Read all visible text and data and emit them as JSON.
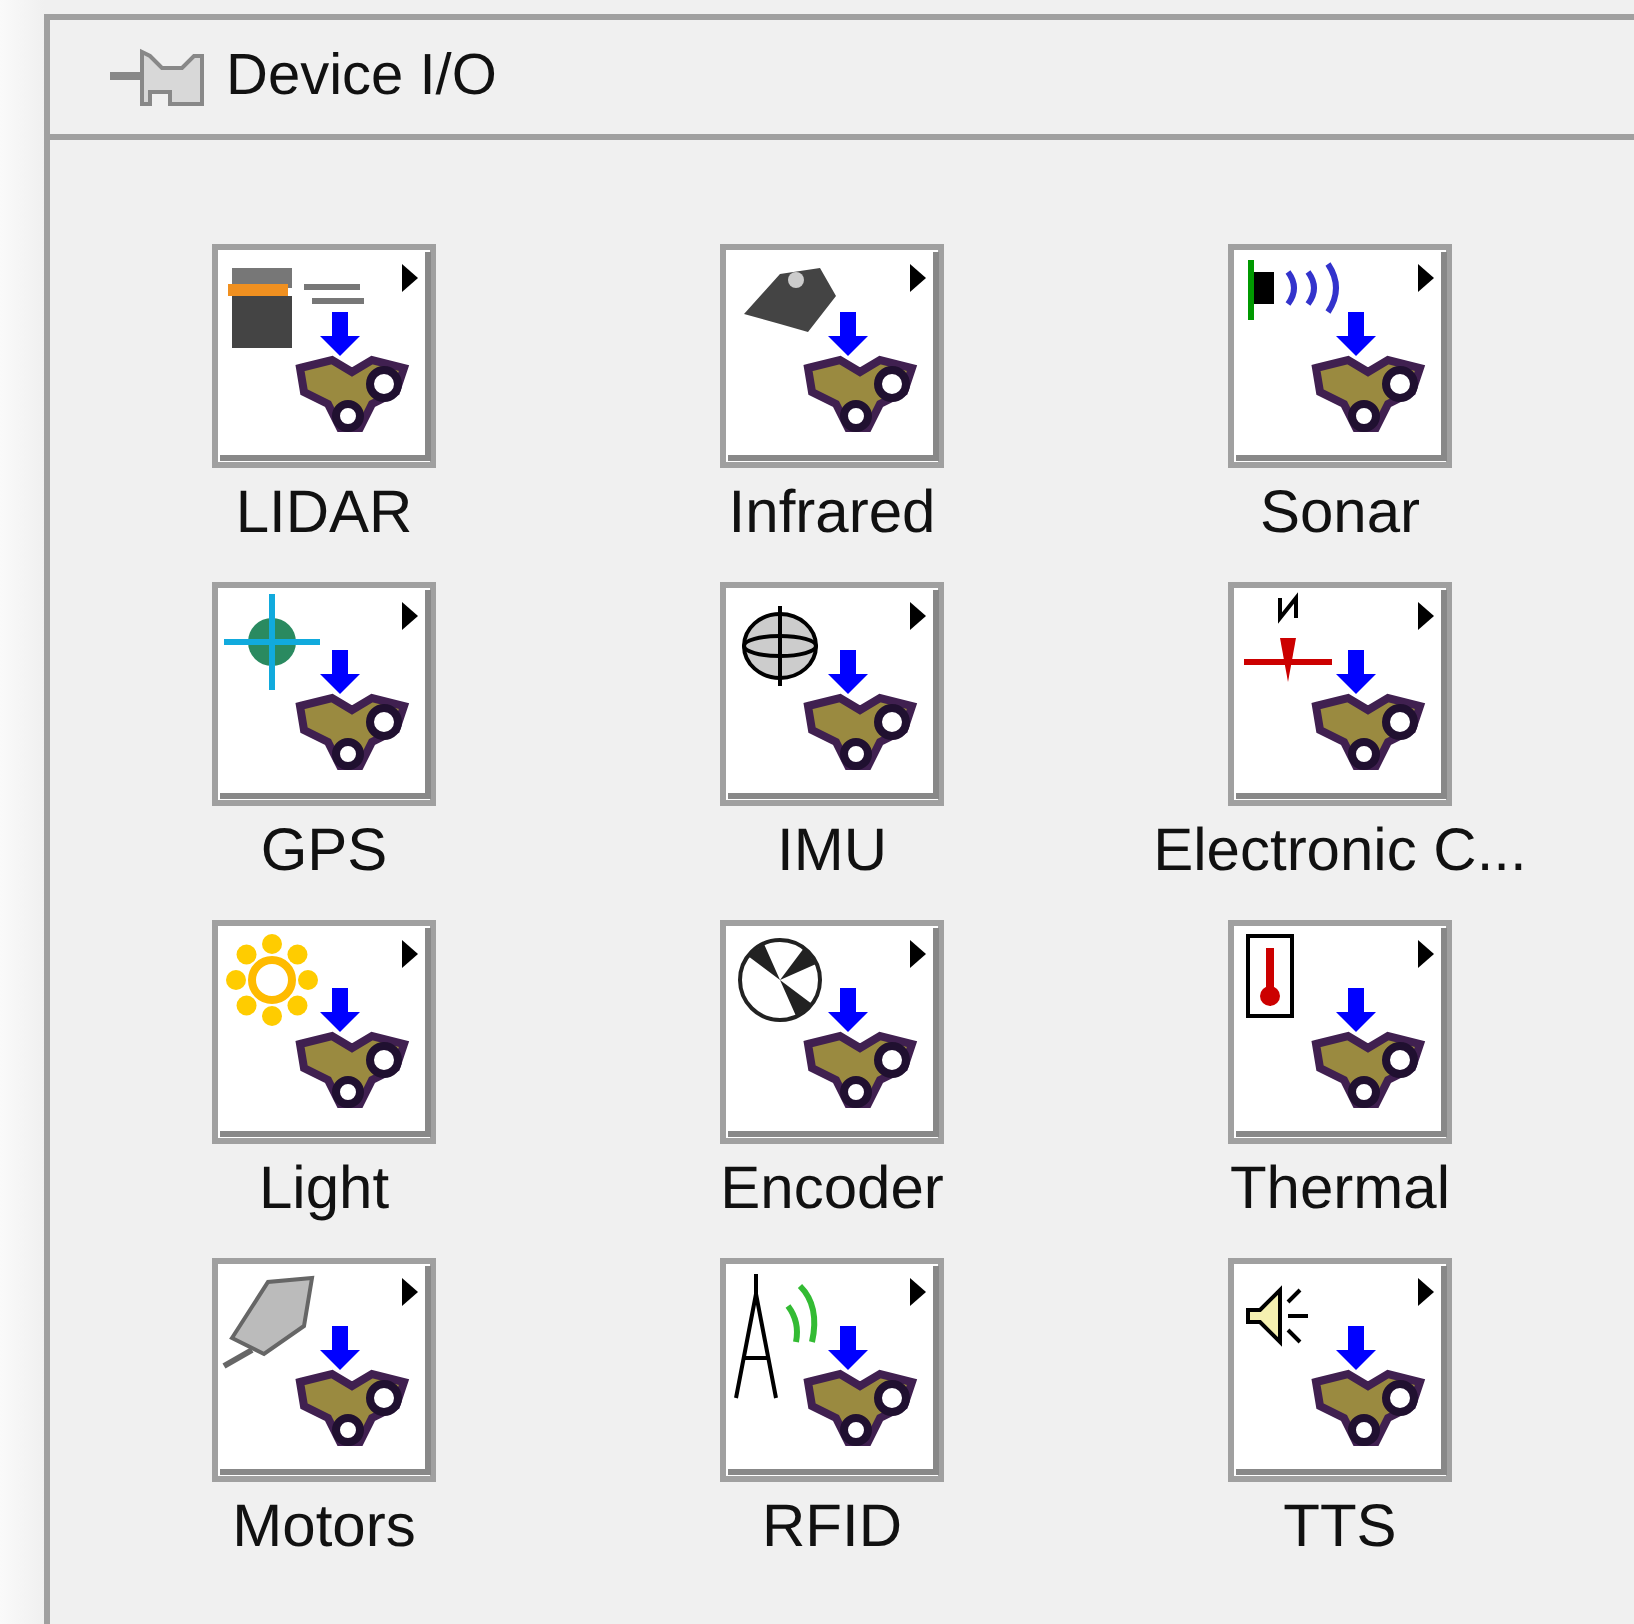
{
  "palette": {
    "title": "Device I/O"
  },
  "items": [
    {
      "label": "LIDAR"
    },
    {
      "label": "Infrared"
    },
    {
      "label": "Sonar"
    },
    {
      "label": "GPS"
    },
    {
      "label": "IMU"
    },
    {
      "label": "Electronic C..."
    },
    {
      "label": "Light"
    },
    {
      "label": "Encoder"
    },
    {
      "label": "Thermal"
    },
    {
      "label": "Motors"
    },
    {
      "label": "RFID"
    },
    {
      "label": "TTS"
    }
  ]
}
